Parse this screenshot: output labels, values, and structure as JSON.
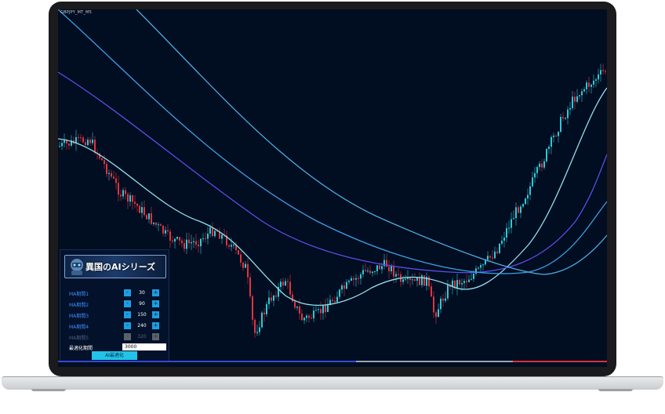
{
  "chart": {
    "symbol": "GBPJPY_MT_M5",
    "colors": {
      "background": "#010d21",
      "bull": "#2ec9d6",
      "bear": "#e0343f",
      "ma1": "#8ee3f0",
      "ma2": "#5c4de6",
      "ma3": "#3b9fe6",
      "ma4": "#4aaee0"
    }
  },
  "panel": {
    "title": "異国のAIシリーズ",
    "rows": [
      {
        "label": "MA期間1",
        "value": "30",
        "minus": "-",
        "plus": "+"
      },
      {
        "label": "MA期間2",
        "value": "90",
        "minus": "-",
        "plus": "+"
      },
      {
        "label": "MA期間3",
        "value": "150",
        "minus": "-",
        "plus": "+"
      },
      {
        "label": "MA期間4",
        "value": "240",
        "minus": "-",
        "plus": "+"
      },
      {
        "label": "MA期間5",
        "value": "320",
        "minus": "-",
        "plus": "+"
      }
    ],
    "optimize_label": "最適化期間",
    "optimize_value": "3000",
    "ai_button": "AI最適化"
  }
}
